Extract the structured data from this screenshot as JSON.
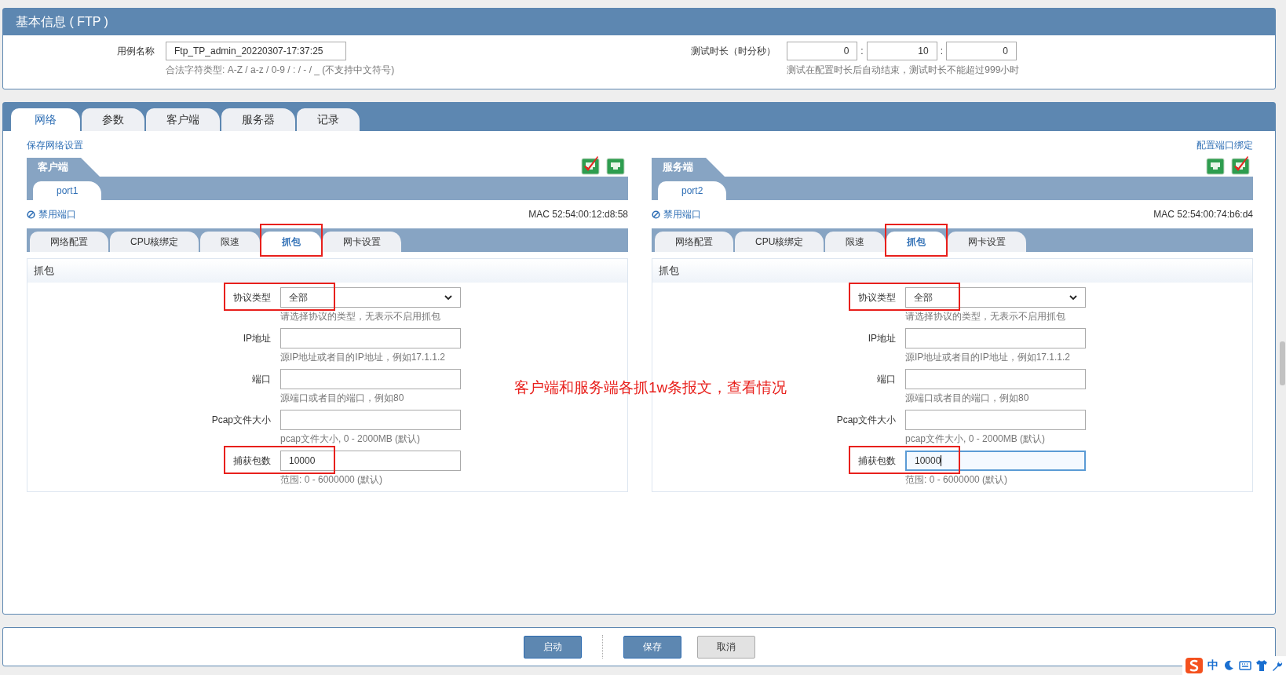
{
  "basic_info": {
    "title": "基本信息 ( FTP )",
    "case_name": {
      "label": "用例名称",
      "value": "Ftp_TP_admin_20220307-17:37:25",
      "hint": "合法字符类型: A-Z / a-z / 0-9 / : / - / _ (不支持中文符号)"
    },
    "duration": {
      "label": "测试时长（时分秒）",
      "fields": [
        "0",
        "10",
        "0"
      ],
      "separator": ":",
      "hint": "测试在配置时长后自动结束，测试时长不能超过999小时"
    }
  },
  "main_tabs": [
    {
      "label": "网络",
      "selected": true
    },
    {
      "label": "参数",
      "selected": false
    },
    {
      "label": "客户端",
      "selected": false
    },
    {
      "label": "服务器",
      "selected": false
    },
    {
      "label": "记录",
      "selected": false
    }
  ],
  "save_link": "保存网络设置",
  "bind_link": "配置端口绑定",
  "panels": [
    {
      "title": "客户端",
      "icons": [
        {
          "kind": "port-checked"
        },
        {
          "kind": "port"
        }
      ],
      "port_tabs": [
        {
          "label": "port1",
          "selected": true
        }
      ],
      "disable_link": "禁用端口",
      "mac": "MAC 52:54:00:12:d8:58",
      "sub_tabs": [
        {
          "label": "网络配置",
          "selected": false,
          "annotated": false
        },
        {
          "label": "CPU核绑定",
          "selected": false,
          "annotated": false
        },
        {
          "label": "限速",
          "selected": false,
          "annotated": false
        },
        {
          "label": "抓包",
          "selected": true,
          "annotated": true
        },
        {
          "label": "网卡设置",
          "selected": false,
          "annotated": false
        }
      ],
      "section": "抓包",
      "fields": [
        {
          "kind": "select",
          "label": "协议类型",
          "value": "全部",
          "hint": "请选择协议的类型，无表示不启用抓包",
          "annotated": true,
          "focused": false
        },
        {
          "kind": "text",
          "label": "IP地址",
          "hint": "源IP地址或者目的IP地址，例如17.1.1.2",
          "annotated": false,
          "focused": false
        },
        {
          "kind": "text",
          "label": "端口",
          "hint": "源端口或者目的端口，例如80",
          "annotated": false,
          "focused": false
        },
        {
          "kind": "text",
          "label": "Pcap文件大小",
          "hint": "pcap文件大小, 0 - 2000MB (默认)",
          "annotated": false,
          "focused": false
        },
        {
          "kind": "text",
          "label": "捕获包数",
          "value": "10000",
          "hint": "范围: 0 - 6000000 (默认)",
          "annotated": true,
          "focused": false
        }
      ]
    },
    {
      "title": "服务端",
      "icons": [
        {
          "kind": "port"
        },
        {
          "kind": "port-checked"
        }
      ],
      "port_tabs": [
        {
          "label": "port2",
          "selected": true
        }
      ],
      "disable_link": "禁用端口",
      "mac": "MAC 52:54:00:74:b6:d4",
      "sub_tabs": [
        {
          "label": "网络配置",
          "selected": false,
          "annotated": false
        },
        {
          "label": "CPU核绑定",
          "selected": false,
          "annotated": false
        },
        {
          "label": "限速",
          "selected": false,
          "annotated": false
        },
        {
          "label": "抓包",
          "selected": true,
          "annotated": true
        },
        {
          "label": "网卡设置",
          "selected": false,
          "annotated": false
        }
      ],
      "section": "抓包",
      "fields": [
        {
          "kind": "select",
          "label": "协议类型",
          "value": "全部",
          "hint": "请选择协议的类型，无表示不启用抓包",
          "annotated": true,
          "focused": false
        },
        {
          "kind": "text",
          "label": "IP地址",
          "hint": "源IP地址或者目的IP地址，例如17.1.1.2",
          "annotated": false,
          "focused": false
        },
        {
          "kind": "text",
          "label": "端口",
          "hint": "源端口或者目的端口，例如80",
          "annotated": false,
          "focused": false
        },
        {
          "kind": "text",
          "label": "Pcap文件大小",
          "hint": "pcap文件大小, 0 - 2000MB (默认)",
          "annotated": false,
          "focused": false
        },
        {
          "kind": "text",
          "label": "捕获包数",
          "value": "10000",
          "hint": "范围: 0 - 6000000 (默认)",
          "annotated": true,
          "focused": true
        }
      ]
    }
  ],
  "annotation": "客户端和服务端各抓1w条报文，查看情况",
  "buttons": [
    {
      "label": "启动",
      "kind": "primary"
    },
    {
      "label": "保存",
      "kind": "primary"
    },
    {
      "label": "取消",
      "kind": "secondary"
    }
  ],
  "ime_toolbar": {
    "mode": "中"
  }
}
